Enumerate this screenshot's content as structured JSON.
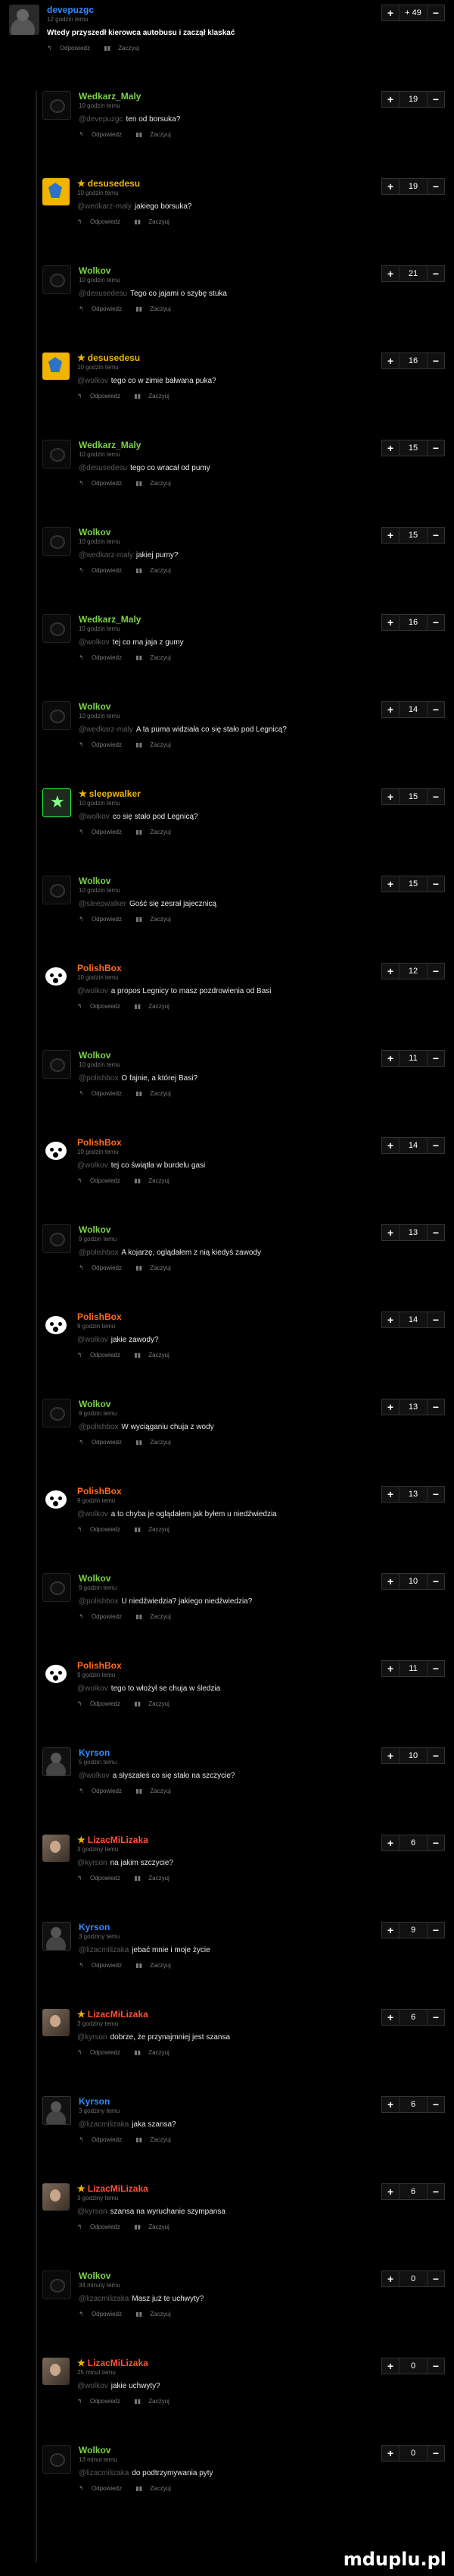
{
  "top": {
    "author": "devepuzgc",
    "time": "12 godzin temu",
    "text": "Wtedy przyszedł kierowca autobusu i zaczął klaskać",
    "score": "+ 49",
    "reply": "Odpowiedz",
    "report": "Zaczyuj"
  },
  "replies": [
    {
      "author": "Wedkarz_Maly",
      "star": false,
      "color": "green",
      "avatar": "black",
      "time": "10 godzin temu",
      "mention": "@devepuzgc",
      "text": "ten od borsuka?",
      "score": "19",
      "reply": "Odpowiedz",
      "report": "Zaczyuj"
    },
    {
      "author": "desusedesu",
      "star": true,
      "color": "yellow",
      "avatar": "yellow",
      "time": "10 godzin temu",
      "mention": "@wedkarz-maly",
      "text": "jakiego borsuka?",
      "score": "19",
      "reply": "Odpowiedz",
      "report": "Zaczyuj"
    },
    {
      "author": "Wolkov",
      "star": false,
      "color": "green",
      "avatar": "black",
      "time": "10 godzin temu",
      "mention": "@desusedesu",
      "text": "Tego co jajami o szybę stuka",
      "score": "21",
      "reply": "Odpowiedz",
      "report": "Zaczyuj"
    },
    {
      "author": "desusedesu",
      "star": true,
      "color": "yellow",
      "avatar": "yellow",
      "time": "10 godzin temu",
      "mention": "@wolkov",
      "text": "tego co w zimie bałwana puka?",
      "score": "16",
      "reply": "Odpowiedz",
      "report": "Zaczyuj"
    },
    {
      "author": "Wedkarz_Maly",
      "star": false,
      "color": "green",
      "avatar": "black",
      "time": "10 godzin temu",
      "mention": "@desusedesu",
      "text": "tego co wracał od pumy",
      "score": "15",
      "reply": "Odpowiedz",
      "report": "Zaczyuj"
    },
    {
      "author": "Wolkov",
      "star": false,
      "color": "green",
      "avatar": "black",
      "time": "10 godzin temu",
      "mention": "@wedkarz-maly",
      "text": "jakiej pumy?",
      "score": "15",
      "reply": "Odpowiedz",
      "report": "Zaczyuj"
    },
    {
      "author": "Wedkarz_Maly",
      "star": false,
      "color": "green",
      "avatar": "black",
      "time": "10 godzin temu",
      "mention": "@wolkov",
      "text": "tej co ma jaja z gumy",
      "score": "16",
      "reply": "Odpowiedz",
      "report": "Zaczyuj"
    },
    {
      "author": "Wolkov",
      "star": false,
      "color": "green",
      "avatar": "black",
      "time": "10 godzin temu",
      "mention": "@wedkarz-maly",
      "text": "A ta puma widziała co się stało pod Legnicą?",
      "score": "14",
      "reply": "Odpowiedz",
      "report": "Zaczyuj"
    },
    {
      "author": "sleepwalker",
      "star": true,
      "color": "yellow",
      "avatar": "green",
      "time": "10 godzin temu",
      "mention": "@wolkov",
      "text": "co się stało pod Legnicą?",
      "score": "15",
      "reply": "Odpowiedz",
      "report": "Zaczyuj"
    },
    {
      "author": "Wolkov",
      "star": false,
      "color": "green",
      "avatar": "black",
      "time": "10 godzin temu",
      "mention": "@sleepwalker",
      "text": "Gość się zesrał jajecznicą",
      "score": "15",
      "reply": "Odpowiedz",
      "report": "Zaczyuj"
    },
    {
      "author": "PolishBox",
      "star": false,
      "color": "orange",
      "avatar": "panda",
      "time": "10 godzin temu",
      "mention": "@wolkov",
      "text": "a propos Legnicy to masz pozdrowienia od Basi",
      "score": "12",
      "reply": "Odpowiedz",
      "report": "Zaczyuj"
    },
    {
      "author": "Wolkov",
      "star": false,
      "color": "green",
      "avatar": "black",
      "time": "10 godzin temu",
      "mention": "@polishbox",
      "text": "O fajnie, a której Basi?",
      "score": "11",
      "reply": "Odpowiedz",
      "report": "Zaczyuj"
    },
    {
      "author": "PolishBox",
      "star": false,
      "color": "orange",
      "avatar": "panda",
      "time": "10 godzin temu",
      "mention": "@wolkov",
      "text": "tej co świątła w burdelu gasi",
      "score": "14",
      "reply": "Odpowiedz",
      "report": "Zaczyuj"
    },
    {
      "author": "Wolkov",
      "star": false,
      "color": "green",
      "avatar": "black",
      "time": "9 godzin temu",
      "mention": "@polishbox",
      "text": "A kojarzę, oglądałem z nią kiedyś zawody",
      "score": "13",
      "reply": "Odpowiedz",
      "report": "Zaczyuj"
    },
    {
      "author": "PolishBox",
      "star": false,
      "color": "orange",
      "avatar": "panda",
      "time": "9 godzin temu",
      "mention": "@wolkov",
      "text": "jakie zawody?",
      "score": "14",
      "reply": "Odpowiedz",
      "report": "Zaczyuj"
    },
    {
      "author": "Wolkov",
      "star": false,
      "color": "green",
      "avatar": "black",
      "time": "9 godzin temu",
      "mention": "@polishbox",
      "text": "W wyciąganiu chuja z wody",
      "score": "13",
      "reply": "Odpowiedz",
      "report": "Zaczyuj"
    },
    {
      "author": "PolishBox",
      "star": false,
      "color": "orange",
      "avatar": "panda",
      "time": "9 godzin temu",
      "mention": "@wolkov",
      "text": "a to chyba je oglądałem jak byłem u niedźwiedzia",
      "score": "13",
      "reply": "Odpowiedz",
      "report": "Zaczyuj"
    },
    {
      "author": "Wolkov",
      "star": false,
      "color": "green",
      "avatar": "black",
      "time": "9 godzin temu",
      "mention": "@polishbox",
      "text": "U niedźwiedzia? jakiego niedźwiedzia?",
      "score": "10",
      "reply": "Odpowiedz",
      "report": "Zaczyuj"
    },
    {
      "author": "PolishBox",
      "star": false,
      "color": "orange",
      "avatar": "panda",
      "time": "9 godzin temu",
      "mention": "@wolkov",
      "text": "tego to włożył se chuja w śledzia",
      "score": "11",
      "reply": "Odpowiedz",
      "report": "Zaczyuj"
    },
    {
      "author": "Kyrson",
      "star": false,
      "color": "blue",
      "avatar": "dark",
      "time": "5 godzin temu",
      "mention": "@wolkov",
      "text": "a słyszałeś co się stało na szczycie?",
      "score": "10",
      "reply": "Odpowiedz",
      "report": "Zaczyuj"
    },
    {
      "author": "LizacMiLizaka",
      "star": true,
      "color": "red",
      "avatar": "photo",
      "time": "3 godziny temu",
      "mention": "@kyrson",
      "text": "na jakim szczycie?",
      "score": "6",
      "reply": "Odpowiedz",
      "report": "Zaczyuj"
    },
    {
      "author": "Kyrson",
      "star": false,
      "color": "blue",
      "avatar": "dark",
      "time": "3 godziny temu",
      "mention": "@lizacmilizaka",
      "text": "jebać mnie i moje życie",
      "score": "9",
      "reply": "Odpowiedz",
      "report": "Zaczyuj"
    },
    {
      "author": "LizacMiLizaka",
      "star": true,
      "color": "red",
      "avatar": "photo",
      "time": "3 godziny temu",
      "mention": "@kyrson",
      "text": "dobrze, że przynajmniej jest szansa",
      "score": "6",
      "reply": "Odpowiedz",
      "report": "Zaczyuj"
    },
    {
      "author": "Kyrson",
      "star": false,
      "color": "blue",
      "avatar": "dark",
      "time": "3 godziny temu",
      "mention": "@lizacmilizaka",
      "text": "jaka szansa?",
      "score": "6",
      "reply": "Odpowiedz",
      "report": "Zaczyuj"
    },
    {
      "author": "LizacMiLizaka",
      "star": true,
      "color": "red",
      "avatar": "photo",
      "time": "3 godziny temu",
      "mention": "@kyrson",
      "text": "szansa na wyruchanie szympansa",
      "score": "6",
      "reply": "Odpowiedz",
      "report": "Zaczyuj"
    },
    {
      "author": "Wolkov",
      "star": false,
      "color": "green",
      "avatar": "black",
      "time": "34 minuty temu",
      "mention": "@lizacmilizaka",
      "text": "Masz już te uchwyty?",
      "score": "0",
      "reply": "Odpowiedz",
      "report": "Zaczyuj"
    },
    {
      "author": "LizacMiLizaka",
      "star": true,
      "color": "red",
      "avatar": "photo",
      "time": "25 minut temu",
      "mention": "@wolkov",
      "text": "jakie uchwyty?",
      "score": "0",
      "reply": "Odpowiedz",
      "report": "Zaczyuj"
    },
    {
      "author": "Wolkov",
      "star": false,
      "color": "green",
      "avatar": "black",
      "time": "13 minut temu",
      "mention": "@lizacmilizaka",
      "text": "do podtrzymywania pyty",
      "score": "0",
      "reply": "Odpowiedz",
      "report": "Zaczyuj"
    }
  ],
  "vote": {
    "plus": "+",
    "minus": "−"
  },
  "icons": {
    "reply": "reply-icon",
    "report": "flag-icon"
  },
  "watermark": "mduplu.pl"
}
